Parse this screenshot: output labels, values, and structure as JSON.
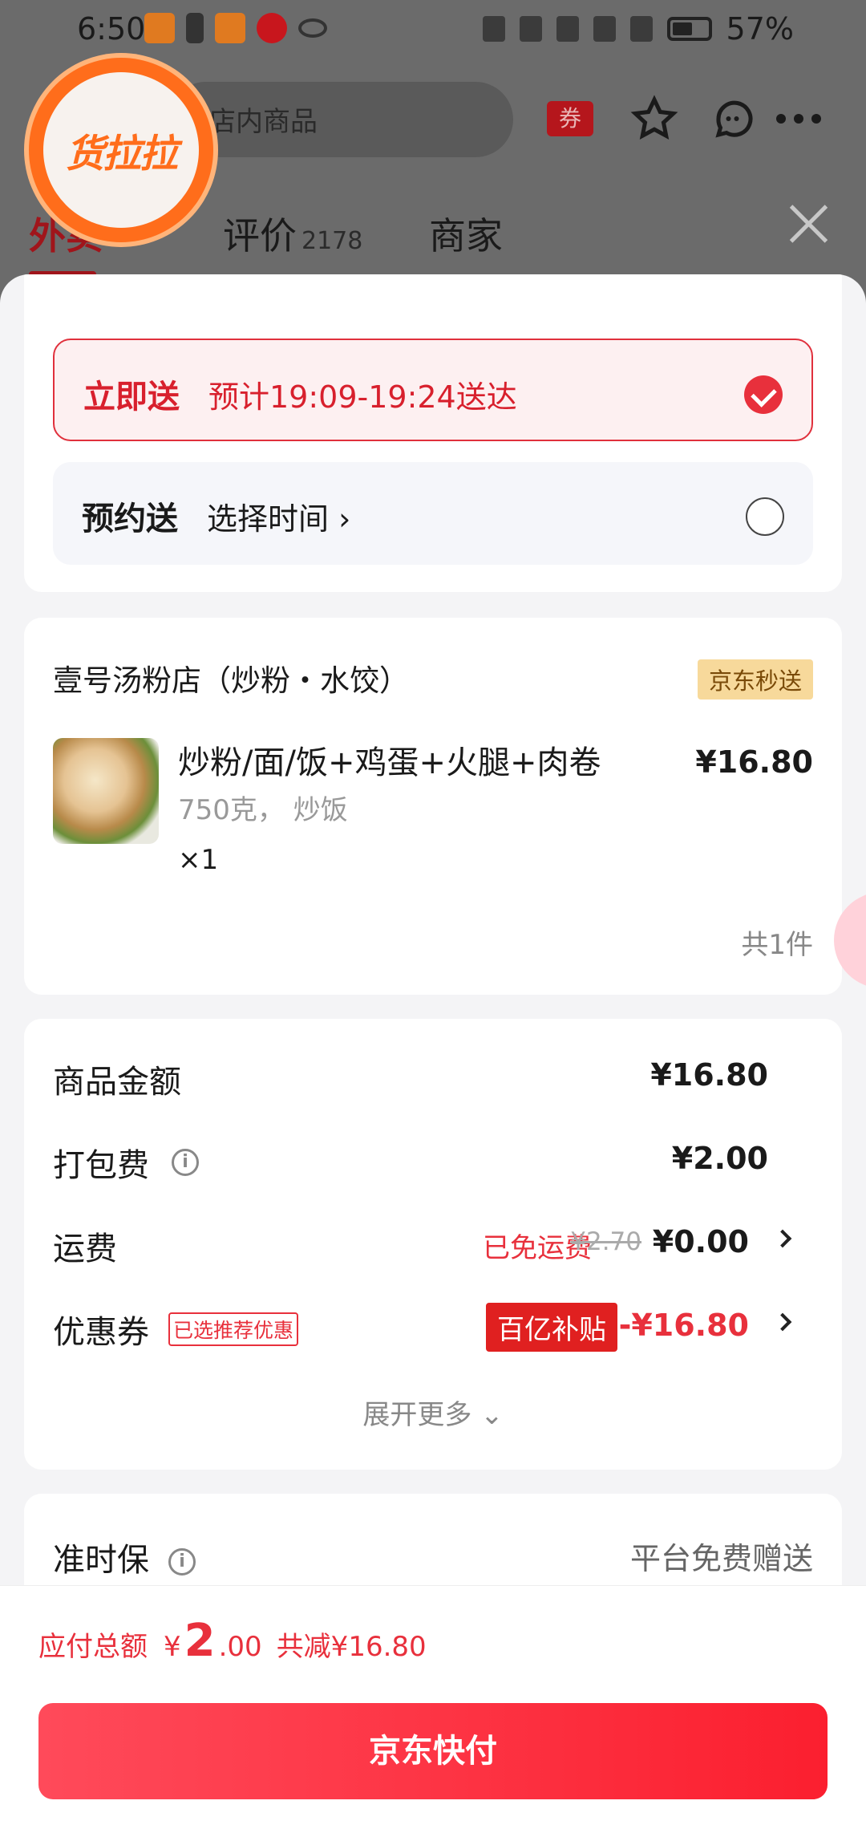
{
  "status_bar": {
    "time": "6:50",
    "battery": "57%"
  },
  "header": {
    "search_placeholder": "店内商品",
    "coupon_label": "券",
    "logo_text": "货拉拉",
    "tabs": [
      {
        "label": "外卖"
      },
      {
        "label": "评价",
        "count": "2178"
      },
      {
        "label": "商家"
      }
    ]
  },
  "delivery": {
    "now": {
      "label": "立即送",
      "detail": "预计19:09-19:24送达",
      "selected": true
    },
    "scheduled": {
      "label": "预约送",
      "detail": "选择时间 ›",
      "selected": false
    }
  },
  "store": {
    "name": "壹号汤粉店（炒粉・水饺）",
    "tag": "京东秒送",
    "item": {
      "name": "炒粉/面/饭+鸡蛋+火腿+肉卷",
      "spec": "750克，  炒饭",
      "qty": "×1",
      "price": "¥16.80"
    },
    "count_text": "共1件"
  },
  "fees": {
    "goods": {
      "label": "商品金额",
      "value": "¥16.80"
    },
    "packing": {
      "label": "打包费",
      "value": "¥2.00",
      "info_icon": "i"
    },
    "shipping": {
      "label": "运费",
      "free_label": "已免运费",
      "original": "¥2.70",
      "value": "¥0.00"
    },
    "coupon": {
      "label": "优惠券",
      "tag": "已选推荐优惠",
      "subsidy_tag": "百亿补贴",
      "value": "-¥16.80"
    },
    "expand": "展开更多 ⌄"
  },
  "ontime": {
    "label": "准时保",
    "value": "平台免费赠送",
    "info_icon": "i"
  },
  "bottom": {
    "total_label": "应付总额",
    "currency": "¥",
    "total_int": "2",
    "total_dec": ".00",
    "saved": "共减¥16.80",
    "pay_label": "京东快付"
  },
  "colors": {
    "accent": "#e8303c",
    "pay_button": "#fb1f2f"
  }
}
